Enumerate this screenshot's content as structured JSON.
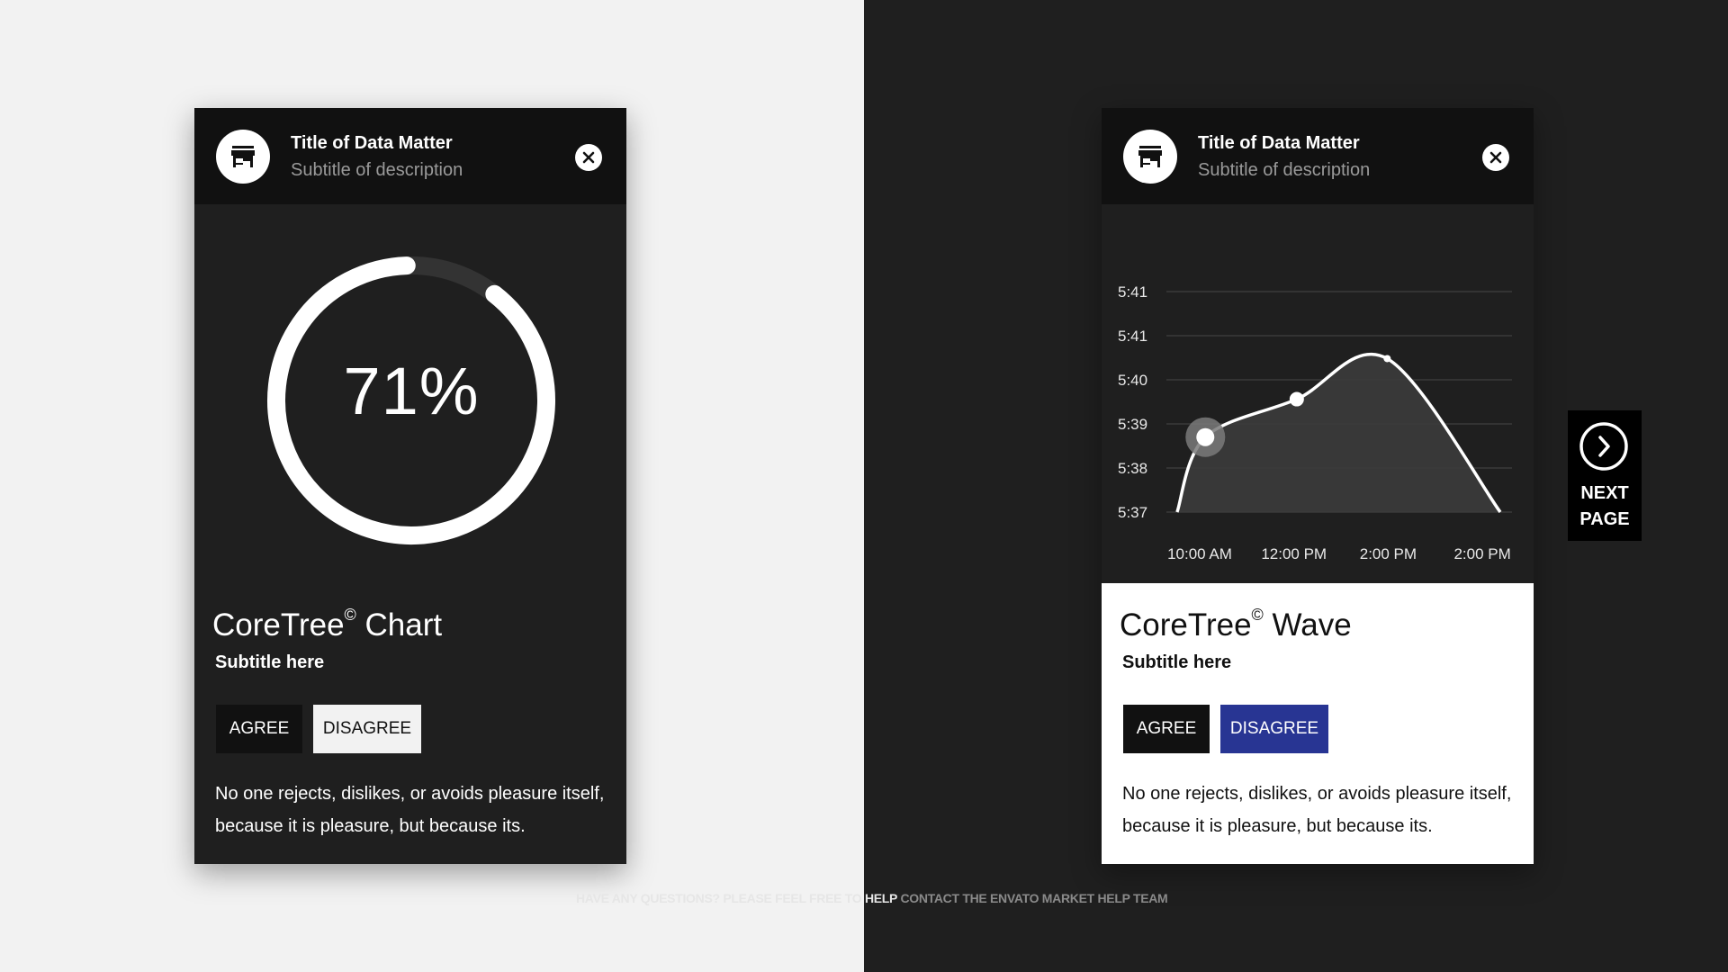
{
  "colors": {
    "page_left_bg": "#f2f2f2",
    "page_right_bg": "#1f1f1f",
    "card_bg": "#1f1f1f",
    "header_bg": "#111111",
    "accent_blue": "#283593",
    "white": "#ffffff"
  },
  "card_left": {
    "header": {
      "icon": "store-icon",
      "title": "Title of Data Matter",
      "subtitle": "Subtitle of description",
      "close_icon": "close-icon"
    },
    "progress": {
      "value_percent": 71,
      "label": "71%"
    },
    "content": {
      "title": "CoreTree",
      "title_mark": "©",
      "title_suffix": " Chart",
      "subtitle": "Subtitle here",
      "agree_label": "AGREE",
      "disagree_label": "DISAGREE",
      "body": "No one rejects, dislikes, or avoids pleasure itself, because it is pleasure, but because its."
    }
  },
  "card_right": {
    "header": {
      "icon": "store-icon",
      "title": "Title of Data Matter",
      "subtitle": "Subtitle of description",
      "close_icon": "close-icon"
    },
    "content": {
      "title": "CoreTree",
      "title_mark": "©",
      "title_suffix": " Wave",
      "subtitle": "Subtitle here",
      "agree_label": "AGREE",
      "disagree_label": "DISAGREE",
      "body": "No one rejects, dislikes, or avoids pleasure itself, because it is pleasure, but because its."
    }
  },
  "chart_data": {
    "type": "area",
    "title": "",
    "xlabel": "",
    "ylabel": "",
    "categories": [
      "10:00 AM",
      "12:00 PM",
      "2:00 PM",
      "2:00 PM"
    ],
    "y_tick_labels": [
      "5:37",
      "5:38",
      "5:39",
      "5:40",
      "5:41",
      "5:41"
    ],
    "ylim_tick_index": [
      0,
      5
    ],
    "grid": true,
    "curve_points_tick_units": [
      {
        "x": -0.24,
        "y": 0
      },
      {
        "x": 0.06,
        "y": 1.7
      },
      {
        "x": 1.03,
        "y": 2.56
      },
      {
        "x": 1.99,
        "y": 3.48
      },
      {
        "x": 3.19,
        "y": 0
      }
    ],
    "markers": [
      {
        "x": 0.06,
        "y": 1.7,
        "highlighted": true
      },
      {
        "x": 1.03,
        "y": 2.56,
        "highlighted": false
      },
      {
        "x": 1.99,
        "y": 3.48,
        "highlighted": false
      }
    ]
  },
  "next_page": {
    "icon": "chevron-right-circle-icon",
    "line1": "NEXT",
    "line2": "PAGE"
  },
  "footer": {
    "faint_text": "HAVE ANY QUESTIONS? PLEASE FEEL FREE TO HELP",
    "text": "CONTACT THE ENVATO MARKET HELP TEAM"
  }
}
